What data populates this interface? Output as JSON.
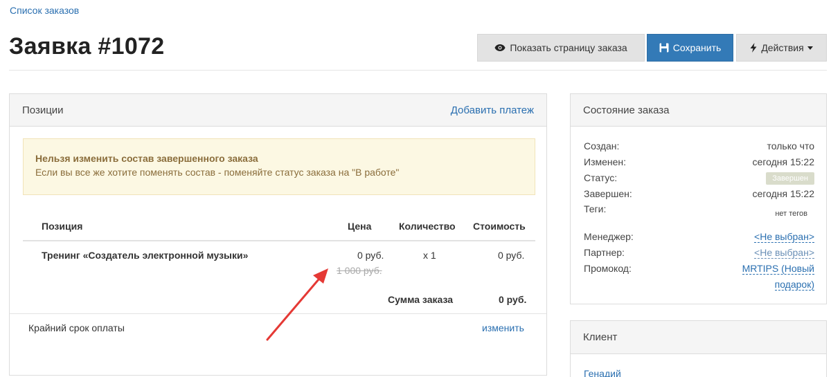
{
  "breadcrumb": "Список заказов",
  "title": "Заявка #1072",
  "buttons": {
    "show_label": "Показать страницу заказа",
    "save_label": "Сохранить",
    "actions_label": "Действия"
  },
  "icons": {
    "show": "eye-icon",
    "save": "floppy-disk-icon",
    "actions": "lightning-bolt-icon",
    "actions_caret": "caret-down-icon"
  },
  "positions_panel": {
    "title": "Позиции",
    "add_payment": "Добавить платеж",
    "warning_title": "Нельзя изменить состав завершенного заказа",
    "warning_text": "Если вы все же хотите поменять состав - поменяйте статус заказа на \"В работе\"",
    "columns": [
      "Позиция",
      "Цена",
      "Количество",
      "Стоимость"
    ],
    "rows": [
      {
        "name": "Тренинг «Создатель электронной музыки»",
        "price": "0 руб.",
        "old_price": "1 000 руб.",
        "quantity": "x 1",
        "cost": "0 руб."
      }
    ],
    "total_label": "Сумма заказа",
    "total_value": "0 руб.",
    "deadline_label": "Крайний срок оплаты",
    "deadline_action": "изменить"
  },
  "state_panel": {
    "title": "Состояние заказа",
    "created_label": "Создан:",
    "created_value": "только что",
    "changed_label": "Изменен:",
    "changed_value": "сегодня 15:22",
    "status_label": "Статус:",
    "status_value": "Завершен",
    "completed_label": "Завершен:",
    "completed_value": "сегодня 15:22",
    "tags_label": "Теги:",
    "tags_value": "нет тегов",
    "manager_label": "Менеджер:",
    "manager_value": "<Не выбран>",
    "partner_label": "Партнер:",
    "partner_value": "<Не выбран>",
    "promo_label": "Промокод:",
    "promo_value_line1": "MRTIPS (Новый",
    "promo_value_line2": "подарок)"
  },
  "client_panel": {
    "title": "Клиент",
    "name": "Генадий"
  },
  "colors": {
    "primary": "#337ab7",
    "link": "#2a6fb0",
    "warning_bg": "#fcf8e3",
    "warning_text": "#8a6d3b",
    "status_badge": "#d9dccb",
    "annotation_arrow": "#e53935"
  }
}
